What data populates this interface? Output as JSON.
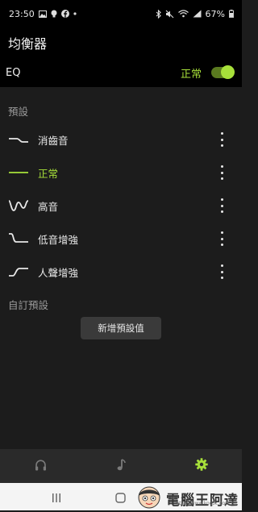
{
  "status_bar": {
    "time": "23:50",
    "battery": "67%"
  },
  "app": {
    "title": "均衡器"
  },
  "eq": {
    "label": "EQ",
    "current_preset": "正常",
    "enabled": true
  },
  "presets_section": {
    "label": "預設",
    "items": [
      {
        "name": "消齒音",
        "icon": "de-esser-curve-icon",
        "active": false
      },
      {
        "name": "正常",
        "icon": "flat-curve-icon",
        "active": true
      },
      {
        "name": "高音",
        "icon": "treble-curve-icon",
        "active": false
      },
      {
        "name": "低音增強",
        "icon": "bass-boost-curve-icon",
        "active": false
      },
      {
        "name": "人聲增強",
        "icon": "vocal-boost-curve-icon",
        "active": false
      }
    ]
  },
  "custom_section": {
    "label": "自訂預設",
    "add_button": "新增預設值"
  },
  "bottom_nav": {
    "tabs": [
      {
        "icon": "headphones-icon",
        "active": false
      },
      {
        "icon": "music-note-icon",
        "active": false
      },
      {
        "icon": "gear-icon",
        "active": true
      }
    ]
  },
  "watermark": {
    "text": "電腦王阿達",
    "url": "http://www.kocpc.com.tw"
  },
  "colors": {
    "accent": "#a7e03a",
    "background": "#1c1c1c",
    "bar": "#000000",
    "nav": "#2a2a2a"
  }
}
